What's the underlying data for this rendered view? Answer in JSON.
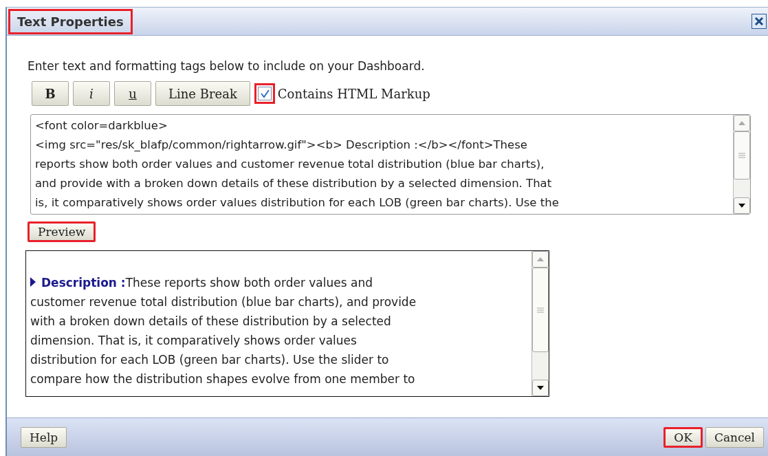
{
  "window": {
    "title": "Text Properties",
    "title_highlighted": true
  },
  "instructions": "Enter text and formatting tags below to include on your Dashboard.",
  "format_buttons": [
    {
      "kind": "bold",
      "label": "B"
    },
    {
      "kind": "italic",
      "label": "i"
    },
    {
      "kind": "underline",
      "label": "u"
    },
    {
      "kind": "plain",
      "label": "Line Break"
    }
  ],
  "html_markup": {
    "label": "Contains HTML Markup",
    "checked": true,
    "highlighted": true
  },
  "editor": {
    "lines": [
      "<font color=darkblue>",
      "<img src=\"res/sk_blafp/common/rightarrow.gif\"><b> Description :</b></font>These",
      "reports show both order values and customer revenue total distribution (blue bar charts),",
      "and provide with a broken down details of these distribution by a selected dimension. That",
      "is, it comparatively shows order values distribution for each LOB (green bar charts). Use the"
    ]
  },
  "preview_button": {
    "label": "Preview",
    "highlighted": true
  },
  "preview": {
    "heading": "Description :",
    "lines": [
      "These reports show both order values and",
      "customer revenue total distribution (blue bar charts), and provide",
      "with a broken down details of these distribution by a selected",
      "dimension. That is, it comparatively shows order values",
      "distribution for each LOB (green bar charts). Use the slider to",
      "compare how the distribution shapes evolve from one member to"
    ]
  },
  "footer": {
    "buttons": [
      {
        "label": "Help",
        "kind": "help",
        "highlighted": false
      },
      {
        "label": "OK",
        "kind": "ok",
        "highlighted": true
      },
      {
        "label": "Cancel",
        "kind": "cancel",
        "highlighted": false
      }
    ]
  }
}
